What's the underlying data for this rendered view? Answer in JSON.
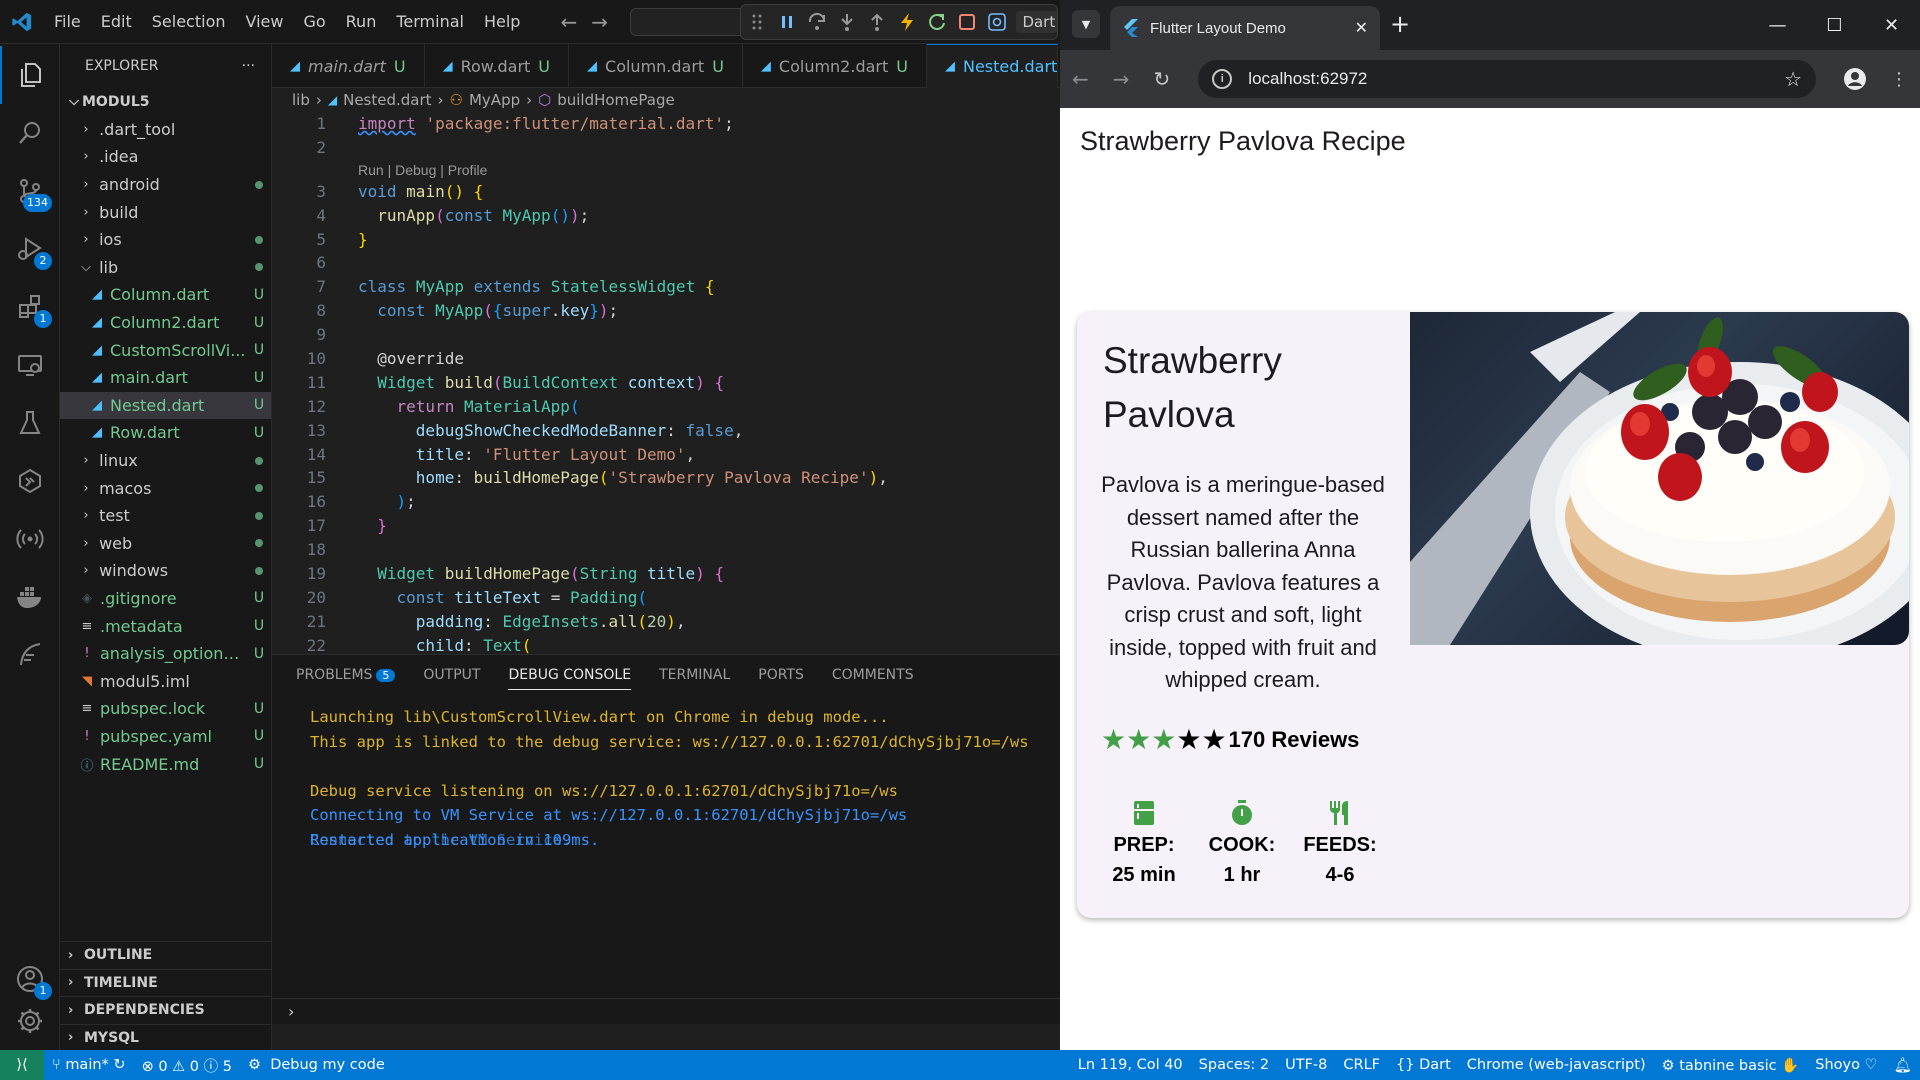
{
  "vscode": {
    "menu": [
      "File",
      "Edit",
      "Selection",
      "View",
      "Go",
      "Run",
      "Terminal",
      "Help"
    ],
    "debug_config": "Dart",
    "activity_badges": {
      "source_control": "134",
      "run_debug": "2",
      "extensions": "1",
      "accounts": "1"
    },
    "explorer": {
      "title": "EXPLORER",
      "more": "···",
      "root": "MODUL5",
      "items": [
        {
          "name": ".dart_tool",
          "type": "folder",
          "status": ""
        },
        {
          "name": ".idea",
          "type": "folder",
          "status": ""
        },
        {
          "name": "android",
          "type": "folder",
          "status": "dot"
        },
        {
          "name": "build",
          "type": "folder",
          "status": ""
        },
        {
          "name": "ios",
          "type": "folder",
          "status": "dot"
        },
        {
          "name": "lib",
          "type": "folder-open",
          "status": "dot"
        },
        {
          "name": "Column.dart",
          "type": "dart",
          "status": "U"
        },
        {
          "name": "Column2.dart",
          "type": "dart",
          "status": "U"
        },
        {
          "name": "CustomScrollVi...",
          "type": "dart",
          "status": "U"
        },
        {
          "name": "main.dart",
          "type": "dart",
          "status": "U"
        },
        {
          "name": "Nested.dart",
          "type": "dart",
          "status": "U"
        },
        {
          "name": "Row.dart",
          "type": "dart",
          "status": "U"
        },
        {
          "name": "linux",
          "type": "folder",
          "status": "dot"
        },
        {
          "name": "macos",
          "type": "folder",
          "status": "dot"
        },
        {
          "name": "test",
          "type": "folder",
          "status": "dot"
        },
        {
          "name": "web",
          "type": "folder",
          "status": "dot"
        },
        {
          "name": "windows",
          "type": "folder",
          "status": "dot"
        },
        {
          "name": ".gitignore",
          "type": "git",
          "status": "U"
        },
        {
          "name": ".metadata",
          "type": "lines",
          "status": "U"
        },
        {
          "name": "analysis_options....",
          "type": "bang",
          "status": "U"
        },
        {
          "name": "modul5.iml",
          "type": "rss",
          "status": ""
        },
        {
          "name": "pubspec.lock",
          "type": "lines",
          "status": "U"
        },
        {
          "name": "pubspec.yaml",
          "type": "bang",
          "status": "U"
        },
        {
          "name": "README.md",
          "type": "info",
          "status": "U"
        }
      ],
      "sections": [
        "OUTLINE",
        "TIMELINE",
        "DEPENDENCIES",
        "MYSQL"
      ]
    },
    "tabs": [
      {
        "label": "main.dart",
        "status": "U"
      },
      {
        "label": "Row.dart",
        "status": "U"
      },
      {
        "label": "Column.dart",
        "status": "U"
      },
      {
        "label": "Column2.dart",
        "status": "U"
      },
      {
        "label": "Nested.dart",
        "status": ""
      }
    ],
    "breadcrumb": {
      "folder": "lib",
      "file": "Nested.dart",
      "cls": "MyApp",
      "method": "buildHomePage"
    },
    "codelens": "Run | Debug | Profile",
    "line_numbers": [
      "1",
      "2",
      "3",
      "4",
      "5",
      "6",
      "7",
      "8",
      "9",
      "10",
      "11",
      "12",
      "13",
      "14",
      "15",
      "16",
      "17",
      "18",
      "19",
      "20",
      "21",
      "22"
    ],
    "panel": {
      "tabs": [
        "PROBLEMS",
        "OUTPUT",
        "DEBUG CONSOLE",
        "TERMINAL",
        "PORTS",
        "COMMENTS"
      ],
      "problems_count": "5",
      "console": [
        {
          "text": "Launching lib\\CustomScrollView.dart on Chrome in debug mode...",
          "color": "yellow"
        },
        {
          "text": "This app is linked to the debug service: ws://127.0.0.1:62701/dChySjbj71o=/ws",
          "color": "yellow"
        },
        {
          "text": "",
          "color": "yellow"
        },
        {
          "text": "Debug service listening on ws://127.0.0.1:62701/dChySjbj71o=/ws",
          "color": "yellow"
        },
        {
          "text": "Connecting to VM Service at ws://127.0.0.1:62701/dChySjbj71o=/ws",
          "color": "blue"
        },
        {
          "text": "Restarted application in 109ms.",
          "color": "blue"
        }
      ],
      "console_overlap": "Connected to the VM Service.",
      "prompt": "›"
    },
    "statusbar": {
      "branch": "main*",
      "errors": "0",
      "warnings": "0",
      "infos": "5",
      "debug": "Debug my code",
      "position": "Ln 119, Col 40",
      "spaces": "Spaces: 2",
      "encoding": "UTF-8",
      "eol": "CRLF",
      "language": "Dart",
      "device": "Chrome (web-javascript)",
      "tabnine": "tabnine basic",
      "user": "Shoyo"
    }
  },
  "chrome": {
    "tab_title": "Flutter Layout Demo",
    "url": "localhost:62972",
    "app_title": "Strawberry Pavlova Recipe",
    "card": {
      "title": "Strawberry Pavlova",
      "description": "Pavlova is a meringue-based dessert named after the Russian ballerina Anna Pavlova. Pavlova features a crisp crust and soft, light inside, topped with fruit and whipped cream.",
      "rating_value": 3,
      "rating_max": 5,
      "reviews": "170 Reviews",
      "icons": [
        {
          "icon": "kitchen-icon",
          "label": "PREP:",
          "value": "25 min"
        },
        {
          "icon": "timer-icon",
          "label": "COOK:",
          "value": "1 hr"
        },
        {
          "icon": "restaurant-icon",
          "label": "FEEDS:",
          "value": "4-6"
        }
      ],
      "accent_color": "#43a047",
      "image": "strawberry-pavlova-photo"
    }
  }
}
